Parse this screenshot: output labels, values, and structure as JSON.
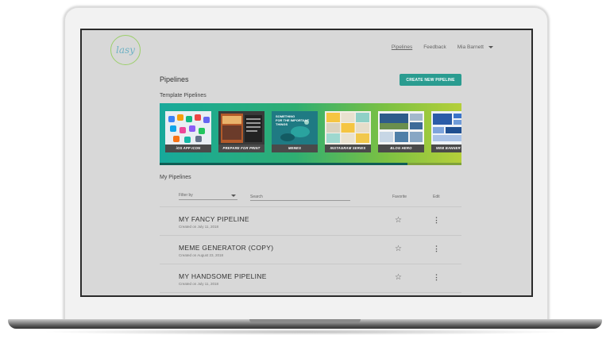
{
  "logo": {
    "text": "lasy"
  },
  "topnav": {
    "pipelines": "Pipelines",
    "feedback": "Feedback",
    "user": "Mia Barnett"
  },
  "page": {
    "title": "Pipelines",
    "create_button": "CREATE NEW PIPELINE"
  },
  "templates": {
    "label": "Template Pipelines",
    "cards": [
      {
        "caption": "iOS APP ICON"
      },
      {
        "caption": "PREPARE FOR PRINT"
      },
      {
        "caption": "MEMES",
        "overlay": "SOMETHING\nFOR THE IMPORTANT\nTHINGS"
      },
      {
        "caption": "INSTAGRAM SERIES"
      },
      {
        "caption": "BLOG HERO"
      },
      {
        "caption": "WEB BANNER"
      }
    ]
  },
  "my_pipelines": {
    "label": "My Pipelines",
    "filter_label": "Filter by",
    "search_placeholder": "Search",
    "col_favorite": "Favorite",
    "col_edit": "Edit",
    "rows": [
      {
        "name": "MY FANCY PIPELINE",
        "date": "Created on July 11, 2018"
      },
      {
        "name": "MEME GENERATOR (COPY)",
        "date": "Created on August 23, 2018"
      },
      {
        "name": "MY HANDSOME PIPELINE",
        "date": "Created on July 11, 2018"
      }
    ]
  },
  "icons": {
    "star": "☆",
    "kebab": "⋮",
    "dropdown": "chevron-down"
  },
  "colors": {
    "accent": "#2a9c90",
    "screen_bg": "#d8d8d8"
  }
}
